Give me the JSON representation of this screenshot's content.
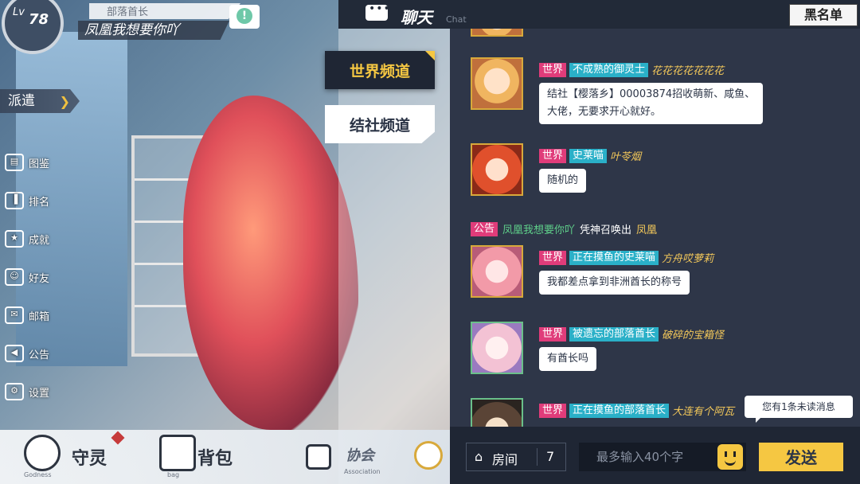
{
  "hud": {
    "level_prefix": "Lv",
    "level": "78",
    "player_title": "部落首长",
    "player_name": "凤凰我想要你吖",
    "alert_glyph": "!",
    "dispatch_label": "派遣",
    "side_menu": [
      {
        "label": "图鉴",
        "icon": "book-icon"
      },
      {
        "label": "排名",
        "icon": "ranking-icon"
      },
      {
        "label": "成就",
        "icon": "trophy-icon"
      },
      {
        "label": "好友",
        "icon": "friends-icon"
      },
      {
        "label": "邮箱",
        "icon": "mail-icon"
      },
      {
        "label": "公告",
        "icon": "megaphone-icon"
      },
      {
        "label": "设置",
        "icon": "gear-icon"
      }
    ],
    "bottom_nav": [
      {
        "label": "守灵",
        "sub": "Godness",
        "icon": "spirit-icon",
        "badge": true
      },
      {
        "label": "背包",
        "sub": "bag",
        "icon": "bag-icon",
        "badge": false
      },
      {
        "label": "协会",
        "sub": "Association",
        "icon": "association-icon",
        "badge": false
      }
    ]
  },
  "channels": {
    "world": "世界频道",
    "guild": "结社频道"
  },
  "chat": {
    "title": "聊天",
    "subtitle": "Chat",
    "blacklist": "黑名单",
    "messages": [
      {
        "channel": "世界",
        "nick": "不成熟的御灵士",
        "title": "花花花花花花花",
        "text_lines": [
          "结社【樱落乡】00003874招收萌新、咸鱼、",
          "大佬，无要求开心就好。"
        ],
        "avatar": "blonde-girl-avatar"
      },
      {
        "channel": "世界",
        "nick": "史莱喵",
        "title": "叶苓烟",
        "text_lines": [
          "随机的"
        ],
        "avatar": "red-hair-girl-avatar"
      },
      {
        "channel": "世界",
        "nick": "正在摸鱼的史莱喵",
        "title": "方舟哎萝莉",
        "text_lines": [
          "我都差点拿到非洲酋长的称号"
        ],
        "avatar": "pink-hair-girl-avatar"
      },
      {
        "channel": "世界",
        "nick": "被遗忘的部落酋长",
        "title": "破碎的宝箱怪",
        "text_lines": [
          "有酋长吗"
        ],
        "avatar": "elf-girl-avatar"
      },
      {
        "channel": "世界",
        "nick": "正在摸鱼的部落首长",
        "title": "大连有个阿瓦",
        "text_lines": [],
        "avatar": "eyepatch-avatar"
      }
    ],
    "announcement": {
      "tag": "公告",
      "player": "凤凰我想要你吖",
      "action": "凭神召唤出",
      "item": "凤凰"
    },
    "unread": "您有1条未读消息"
  },
  "input": {
    "room_label": "房间",
    "room_number": "7",
    "placeholder": "最多输入40个字",
    "send": "发送"
  }
}
